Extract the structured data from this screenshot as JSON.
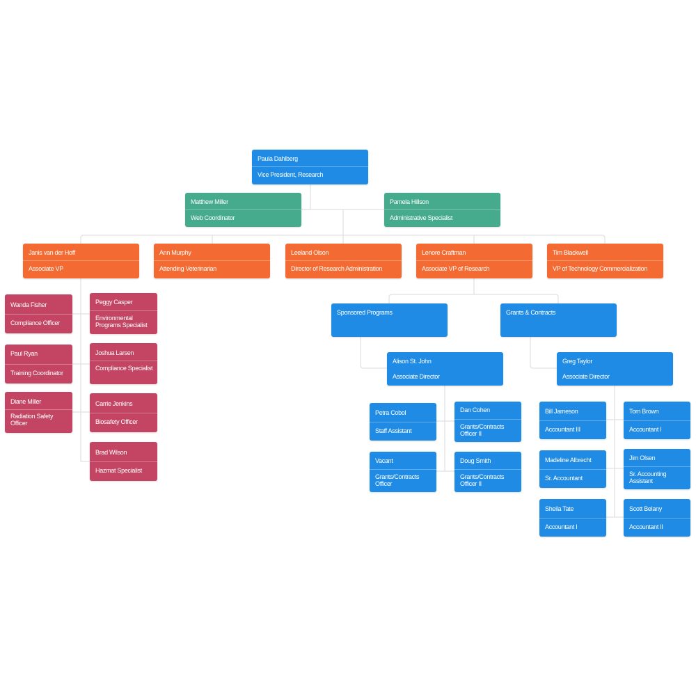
{
  "colors": {
    "blue": "#1f8be4",
    "green": "#46ab8c",
    "orange": "#f36b33",
    "red": "#c34563",
    "connector": "#e0e0e0"
  },
  "nodes": [
    {
      "id": "paula",
      "name": "Paula Dahlberg",
      "title": "Vice President, Research",
      "color": "blue",
      "parent": null
    },
    {
      "id": "matthew",
      "name": "Matthew Miller",
      "title": "Web Coordinator",
      "color": "green",
      "parent": "paula"
    },
    {
      "id": "pamela",
      "name": "Pamela Hillson",
      "title": "Administrative Specialist",
      "color": "green",
      "parent": "paula"
    },
    {
      "id": "janis",
      "name": "Janis van der Hoff",
      "title": "Associate VP",
      "color": "orange",
      "parent": "paula"
    },
    {
      "id": "ann",
      "name": "Ann Murphy",
      "title": "Attending Veterinarian",
      "color": "orange",
      "parent": "paula"
    },
    {
      "id": "leeland",
      "name": "Leeland Olson",
      "title": "Director of Research Administration",
      "color": "orange",
      "parent": "paula"
    },
    {
      "id": "lenore",
      "name": "Lenore Craftman",
      "title": "Associate VP of Research",
      "color": "orange",
      "parent": "paula"
    },
    {
      "id": "tim",
      "name": "Tim Blackwell",
      "title": "VP of Technology Commercialization",
      "color": "orange",
      "parent": "paula"
    },
    {
      "id": "wanda",
      "name": "Wanda Fisher",
      "title": "Compliance Officer",
      "color": "red",
      "parent": "janis"
    },
    {
      "id": "peggy",
      "name": "Peggy Casper",
      "title": "Environmental Programs Specialist",
      "color": "red",
      "parent": "janis"
    },
    {
      "id": "paul",
      "name": "Paul Ryan",
      "title": "Training Coordinator",
      "color": "red",
      "parent": "janis"
    },
    {
      "id": "joshua",
      "name": "Joshua Larsen",
      "title": "Compliance Specialist",
      "color": "red",
      "parent": "janis"
    },
    {
      "id": "diane",
      "name": "Diane Miller",
      "title": "Radiation Safety Officer",
      "color": "red",
      "parent": "janis"
    },
    {
      "id": "carrie",
      "name": "Carrie Jenkins",
      "title": "Biosafety Officer",
      "color": "red",
      "parent": "janis"
    },
    {
      "id": "brad",
      "name": "Brad Wilson",
      "title": "Hazmat Specialist",
      "color": "red",
      "parent": "janis"
    },
    {
      "id": "sponsored",
      "name": "Sponsored Programs",
      "title": "",
      "color": "blue",
      "parent": "lenore"
    },
    {
      "id": "grants",
      "name": "Grants & Contracts",
      "title": "",
      "color": "blue",
      "parent": "lenore"
    },
    {
      "id": "alison",
      "name": "Alison St. John",
      "title": "Associate Director",
      "color": "blue",
      "parent": "sponsored"
    },
    {
      "id": "greg",
      "name": "Greg Taylor",
      "title": "Associate Director",
      "color": "blue",
      "parent": "grants"
    },
    {
      "id": "petra",
      "name": "Petra Cobol",
      "title": "Staff Assistant",
      "color": "blue",
      "parent": "alison"
    },
    {
      "id": "dan",
      "name": "Dan Cohen",
      "title": "Grants/Contracts Officer II",
      "color": "blue",
      "parent": "alison"
    },
    {
      "id": "vacant",
      "name": "Vacant",
      "title": "Grants/Contracts Officer",
      "color": "blue",
      "parent": "alison"
    },
    {
      "id": "doug",
      "name": "Doug Smith",
      "title": "Grants/Contracts Officer II",
      "color": "blue",
      "parent": "alison"
    },
    {
      "id": "bill",
      "name": "Bill Jameson",
      "title": "Accountant III",
      "color": "blue",
      "parent": "greg"
    },
    {
      "id": "tom",
      "name": "Tom Brown",
      "title": "Accountant I",
      "color": "blue",
      "parent": "greg"
    },
    {
      "id": "madeline",
      "name": "Madeline Albrecht",
      "title": "Sr. Accountant",
      "color": "blue",
      "parent": "greg"
    },
    {
      "id": "jim",
      "name": "Jim Olsen",
      "title": "Sr. Accounting Assistant",
      "color": "blue",
      "parent": "greg"
    },
    {
      "id": "sheila",
      "name": "Sheila Tate",
      "title": "Accountant I",
      "color": "blue",
      "parent": "greg"
    },
    {
      "id": "scott",
      "name": "Scott Belany",
      "title": "Accountant II",
      "color": "blue",
      "parent": "greg"
    }
  ]
}
